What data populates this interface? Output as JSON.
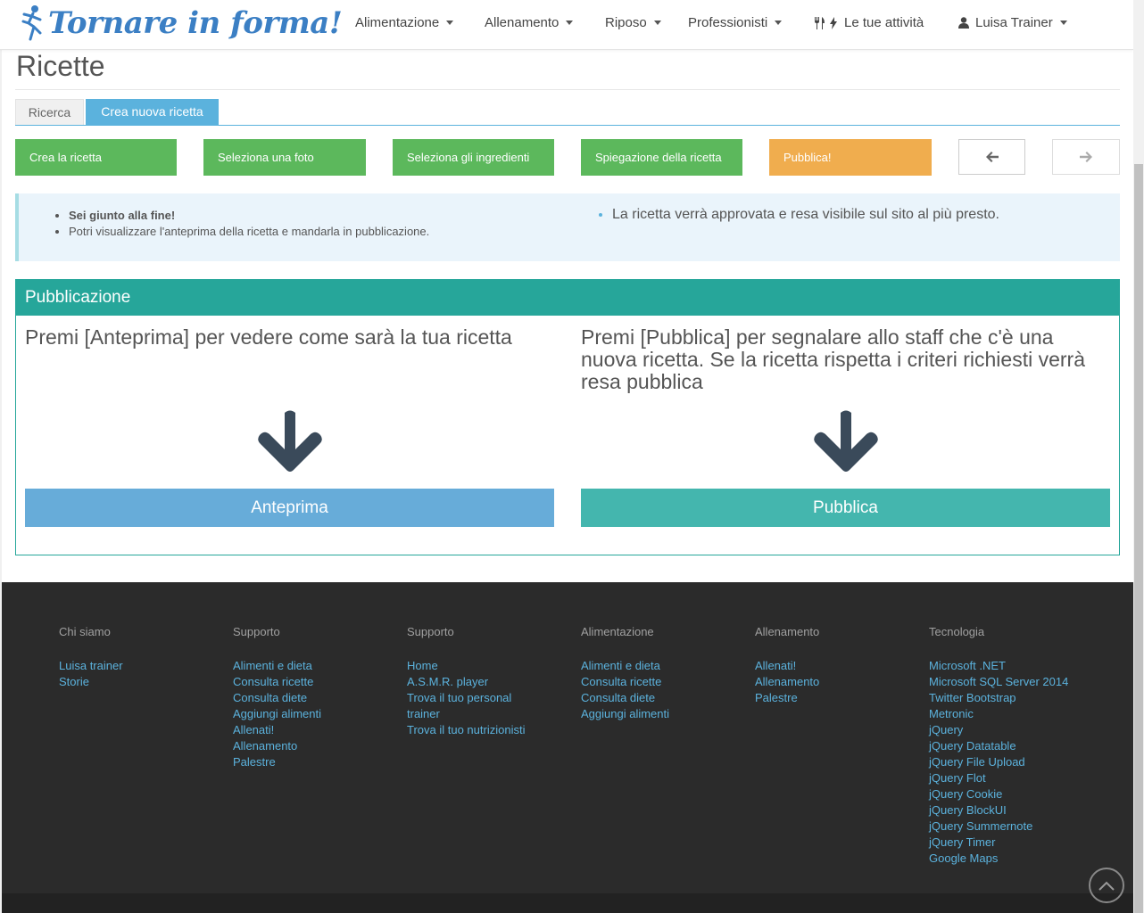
{
  "brand": {
    "name": "Tornare in forma!",
    "color": "#3b7fc4"
  },
  "nav": {
    "items": [
      {
        "label": "Alimentazione"
      },
      {
        "label": "Allenamento"
      },
      {
        "label": "Riposo"
      },
      {
        "label": "Professionisti"
      },
      {
        "label": "Le tue attività"
      },
      {
        "label": "Luisa Trainer"
      }
    ]
  },
  "page": {
    "title": "Ricette"
  },
  "tabs": [
    {
      "label": "Ricerca"
    },
    {
      "label": "Crea nuova ricetta"
    }
  ],
  "steps": [
    {
      "label": "Crea la ricetta"
    },
    {
      "label": "Seleziona una foto"
    },
    {
      "label": "Seleziona gli ingredienti"
    },
    {
      "label": "Spiegazione della ricetta"
    },
    {
      "label": "Pubblica!"
    }
  ],
  "alert": {
    "left_strong": "Sei giunto alla fine!",
    "left_text": "Potri visualizzare l'anteprima della ricetta e mandarla in pubblicazione.",
    "right_text": "La ricetta verrà approvata e resa visibile sul sito al più presto."
  },
  "portlet": {
    "title": "Pubblicazione",
    "preview_text": "Premi [Anteprima] per vedere come sarà la tua ricetta",
    "publish_text": "Premi [Pubblica] per segnalare allo staff che c'è una nuova ricetta. Se la ricetta rispetta i criteri richiesti verrà resa pubblica",
    "preview_button": "Anteprima",
    "publish_button": "Pubblica"
  },
  "footer": {
    "columns": [
      {
        "title": "Chi siamo",
        "links": [
          "Luisa trainer",
          "Storie"
        ]
      },
      {
        "title": "Supporto",
        "links": [
          "Alimenti e dieta",
          "Consulta ricette",
          "Consulta diete",
          "Aggiungi alimenti",
          "Allenati!",
          "Allenamento",
          "Palestre"
        ]
      },
      {
        "title": "Supporto",
        "links": [
          "Home",
          "A.S.M.R. player",
          "Trova il tuo personal",
          "trainer",
          "Trova il tuo nutrizionisti"
        ]
      },
      {
        "title": "Alimentazione",
        "links": [
          "Alimenti e dieta",
          "Consulta ricette",
          "Consulta diete",
          "Aggiungi alimenti"
        ]
      },
      {
        "title": "Allenamento",
        "links": [
          "Allenati!",
          "Allenamento",
          "Palestre"
        ]
      },
      {
        "title": "Tecnologia",
        "links": [
          "Microsoft .NET",
          "Microsoft SQL Server 2014",
          "Twitter Bootstrap",
          "Metronic",
          "jQuery",
          "jQuery Datatable",
          "jQuery File Upload",
          "jQuery Flot",
          "jQuery Cookie",
          "jQuery BlockUI",
          "jQuery Summernote",
          "jQuery Timer",
          "Google Maps"
        ]
      }
    ]
  },
  "colors": {
    "green": "#5cb85c",
    "orange": "#f0ad4e",
    "teal": "#26a69a",
    "blue": "#67acd9",
    "footer": "#2b2b2b",
    "link": "#5bb2dd"
  }
}
